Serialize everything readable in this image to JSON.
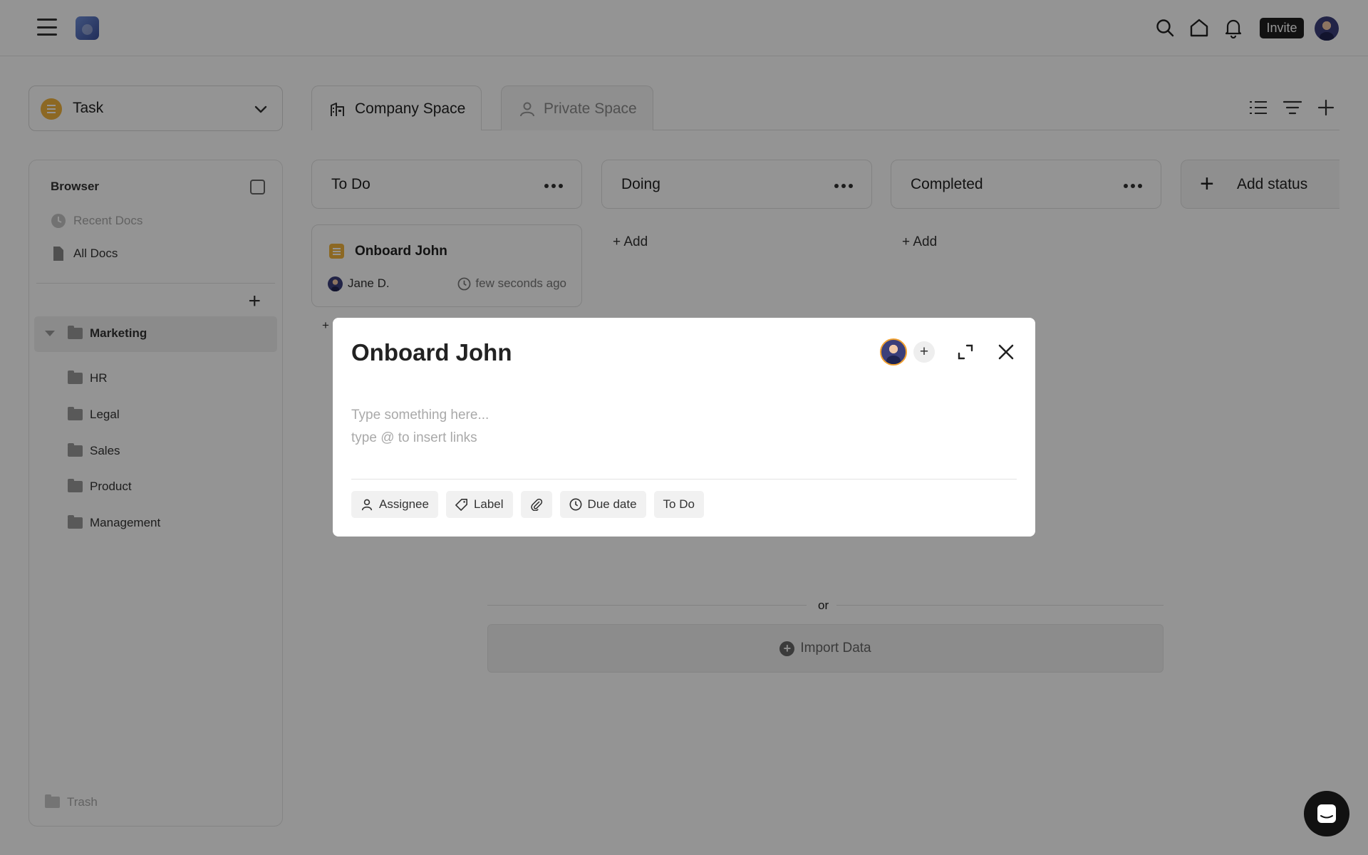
{
  "topbar": {
    "invite_label": "Invite"
  },
  "task_selector": {
    "value": "Task"
  },
  "spaces": {
    "tabs": [
      {
        "label": "Company Space",
        "active": true
      },
      {
        "label": "Private Space",
        "active": false
      }
    ]
  },
  "sidebar": {
    "title": "Browser",
    "recent_label": "Recent Docs",
    "all_docs_label": "All Docs",
    "expanded_folder": "Marketing",
    "folders": [
      "HR",
      "Legal",
      "Sales",
      "Product",
      "Management"
    ],
    "trash_label": "Trash"
  },
  "board": {
    "columns": [
      {
        "label": "To Do"
      },
      {
        "label": "Doing"
      },
      {
        "label": "Completed"
      }
    ],
    "add_status_label": "Add status",
    "add_label": "+ Add",
    "card": {
      "title": "Onboard John",
      "assignee": "Jane D.",
      "time": "few seconds ago"
    },
    "stray_plus": "+",
    "or_label": "or",
    "import_label": "Import Data"
  },
  "modal": {
    "title": "Onboard John",
    "placeholder_line1": "Type something here...",
    "placeholder_line2": "type @ to insert links",
    "chips": {
      "assignee": "Assignee",
      "label": "Label",
      "due_date": "Due date",
      "status": "To Do"
    }
  },
  "colors": {
    "accent": "#f2b33d",
    "overlay": "rgba(0,0,0,0.42)",
    "invite_bg": "#1e1e1e"
  }
}
